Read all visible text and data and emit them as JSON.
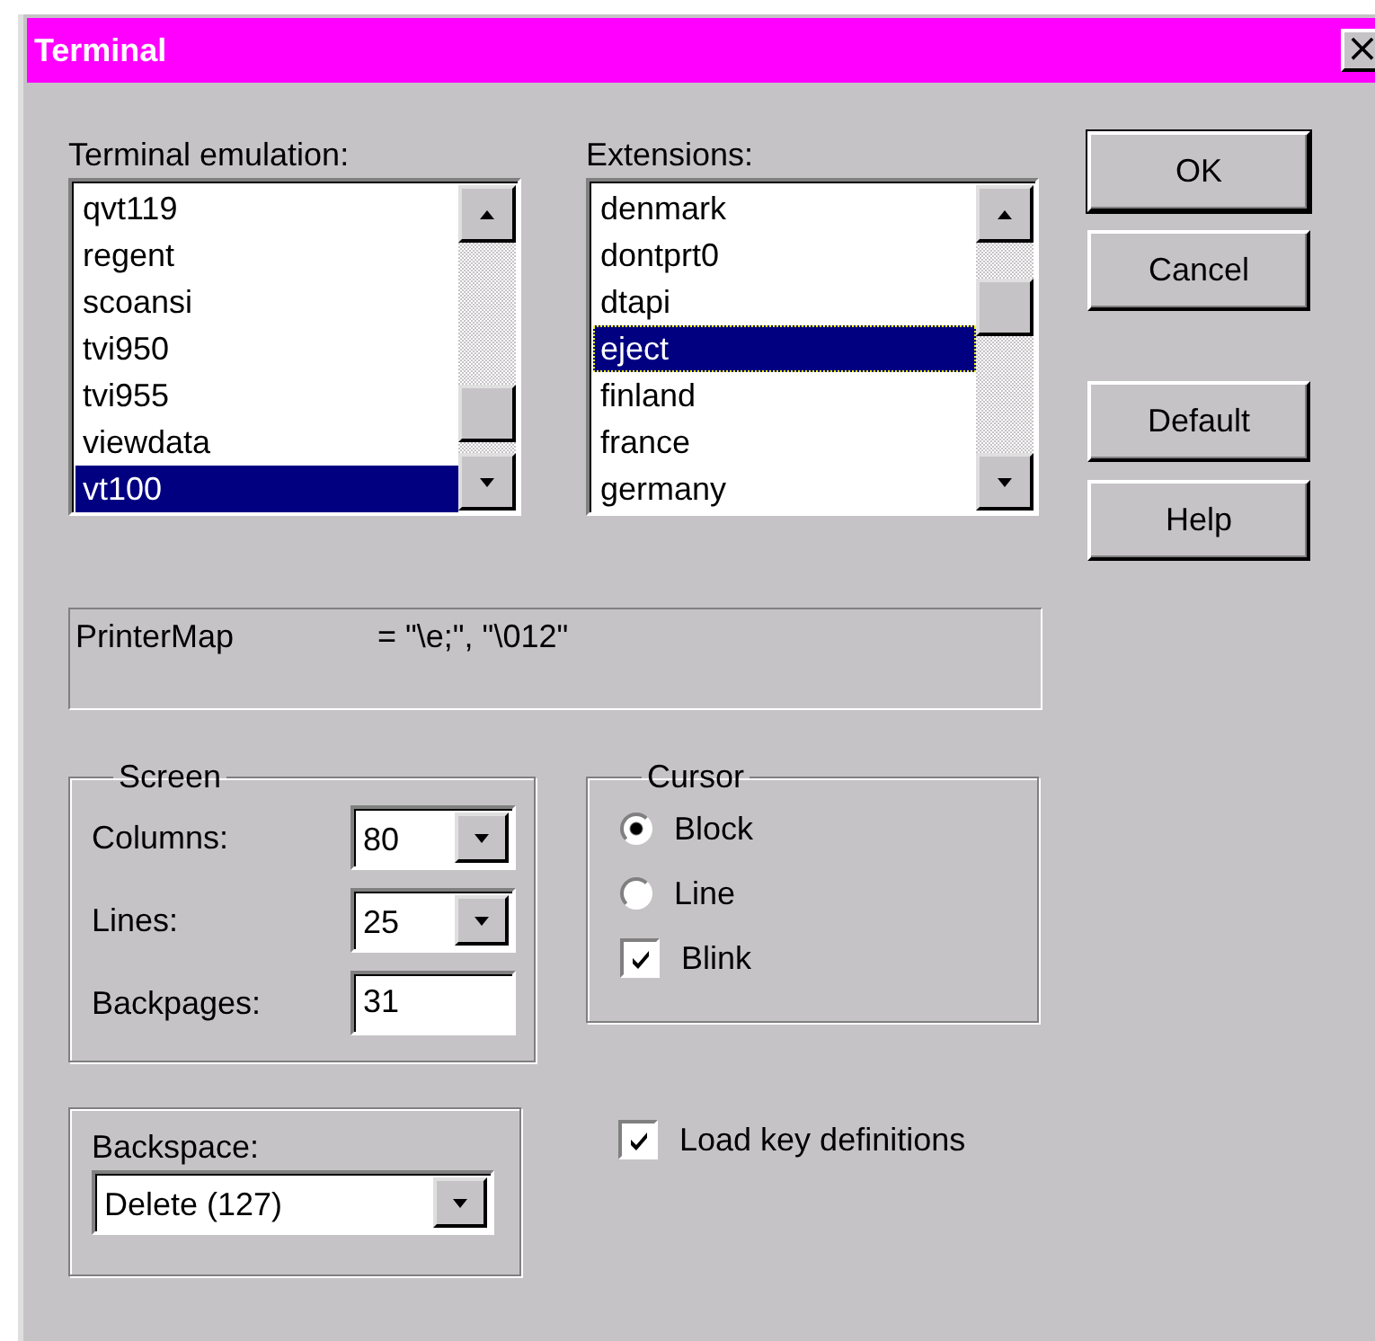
{
  "window": {
    "title": "Terminal",
    "close": "×"
  },
  "emulation": {
    "label": "Terminal emulation:",
    "items": [
      {
        "label": "qvt119",
        "selected": false
      },
      {
        "label": "regent",
        "selected": false
      },
      {
        "label": "scoansi",
        "selected": false
      },
      {
        "label": "tvi950",
        "selected": false
      },
      {
        "label": "tvi955",
        "selected": false
      },
      {
        "label": "viewdata",
        "selected": false
      },
      {
        "label": "vt100",
        "selected": true
      }
    ]
  },
  "extensions": {
    "label": "Extensions:",
    "items": [
      {
        "label": "denmark",
        "selected": false
      },
      {
        "label": "dontprt0",
        "selected": false
      },
      {
        "label": "dtapi",
        "selected": false
      },
      {
        "label": "eject",
        "selected": true
      },
      {
        "label": "finland",
        "selected": false
      },
      {
        "label": "france",
        "selected": false
      },
      {
        "label": "germany",
        "selected": false
      }
    ]
  },
  "buttons": [
    {
      "label": "OK",
      "default": true
    },
    {
      "label": "Cancel",
      "default": false
    },
    {
      "label": "Default",
      "default": false
    },
    {
      "label": "Help",
      "default": false
    }
  ],
  "printer_map": {
    "key": "PrinterMap",
    "value": "= \"\\e;\", \"\\012\""
  },
  "screen": {
    "title": "Screen",
    "fields": [
      {
        "kind": "combo",
        "label": "Columns:",
        "value": "80"
      },
      {
        "kind": "combo",
        "label": "Lines:",
        "value": "25"
      },
      {
        "kind": "text",
        "label": "Backpages:",
        "value": "31"
      }
    ]
  },
  "cursor": {
    "title": "Cursor",
    "options": [
      {
        "kind": "radio",
        "label": "Block",
        "selected": true
      },
      {
        "kind": "radio",
        "label": "Line",
        "selected": false
      },
      {
        "kind": "checkbox",
        "label": "Blink",
        "checked": true
      }
    ]
  },
  "backspace": {
    "label": "Backspace:",
    "value": "Delete (127)"
  },
  "load_keys": {
    "label": "Load key definitions",
    "checked": true
  }
}
